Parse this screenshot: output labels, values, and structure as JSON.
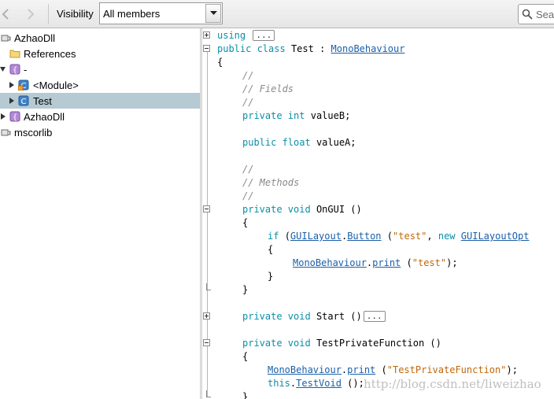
{
  "toolbar": {
    "visibility_label": "Visibility",
    "visibility_select": "All members",
    "search_placeholder": "Sea"
  },
  "tree": [
    {
      "label": "AzhaoDll",
      "icon": "assembly-icon",
      "arrow": "none",
      "level": 0
    },
    {
      "label": "References",
      "icon": "folder-icon",
      "arrow": "none",
      "level": 1
    },
    {
      "label": "-",
      "icon": "namespace-icon",
      "arrow": "expanded",
      "level": 0
    },
    {
      "label": "<Module>",
      "icon": "module-class-icon",
      "arrow": "collapsed",
      "level": 1
    },
    {
      "label": "Test",
      "icon": "class-icon",
      "arrow": "collapsed",
      "level": 1,
      "selected": true
    },
    {
      "label": "AzhaoDll",
      "icon": "namespace-icon",
      "arrow": "collapsed",
      "level": 0
    },
    {
      "label": "mscorlib",
      "icon": "assembly-icon",
      "arrow": "none",
      "level": 0
    }
  ],
  "code": {
    "l1": [
      "using"
    ],
    "l2": [
      "public class",
      "Test",
      ":",
      "MonoBehaviour"
    ],
    "l3": [
      "{"
    ],
    "l4": [
      "//"
    ],
    "l5": [
      "// Fields"
    ],
    "l6": [
      "//"
    ],
    "l7": [
      "private int",
      "valueB;"
    ],
    "l8": [
      "public float",
      "valueA;"
    ],
    "l9": [
      "//"
    ],
    "l10": [
      "// Methods"
    ],
    "l11": [
      "//"
    ],
    "l12": [
      "private void",
      "OnGUI ()"
    ],
    "l13": [
      "{"
    ],
    "l14": [
      "if",
      "(",
      "GUILayout",
      ".",
      "Button",
      "(",
      "\"test\"",
      ",",
      "new",
      "GUILayoutOpt"
    ],
    "l15": [
      "{"
    ],
    "l16": [
      "MonoBehaviour",
      ".",
      "print",
      "(",
      "\"test\"",
      ");"
    ],
    "l17": [
      "}"
    ],
    "l18": [
      "}"
    ],
    "l19": [
      "private void",
      "Start ()"
    ],
    "l20": [
      "private void",
      "TestPrivateFunction ()"
    ],
    "l21": [
      "{"
    ],
    "l22": [
      "MonoBehaviour",
      ".",
      "print",
      "(",
      "\"TestPrivateFunction\"",
      ");"
    ],
    "l23": [
      "this",
      ".",
      "TestVoid",
      "();"
    ],
    "l24": [
      "}"
    ],
    "collapsed_marker": "..."
  },
  "watermark": "http://blog.csdn.net/liweizhao",
  "colors": {
    "keyword": "#0a8fa8",
    "comment": "#8a8a8a",
    "type_link": "#1b5fa8",
    "string": "#c0670a",
    "selection": "#b5cad2"
  }
}
